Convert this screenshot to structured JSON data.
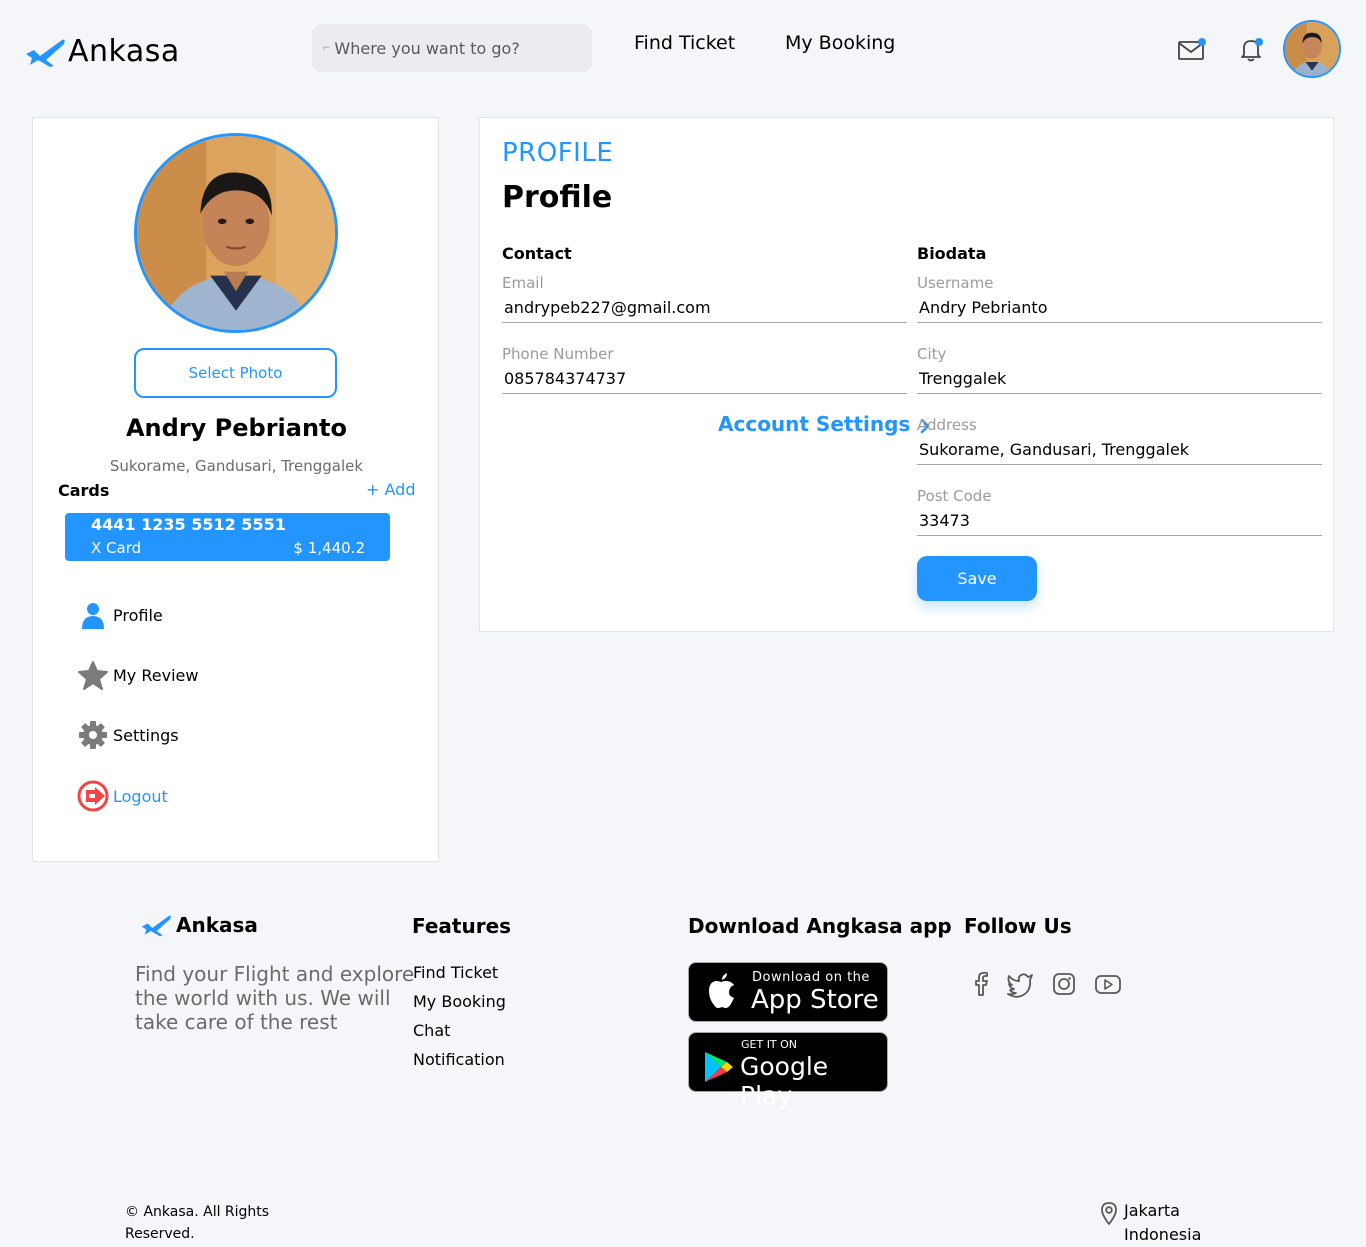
{
  "header": {
    "brand": "Ankasa",
    "search_placeholder": "Where you want to go?",
    "nav": [
      "Find Ticket",
      "My Booking"
    ]
  },
  "sidebar": {
    "select_photo_label": "Select Photo",
    "user_name": "Andry Pebrianto",
    "user_address": "Sukorame, Gandusari, Trenggalek",
    "cards_label": "Cards",
    "add_label": "+ Add",
    "card": {
      "number": "4441 1235 5512 5551",
      "name": "X Card",
      "balance": "$ 1,440.2"
    },
    "menu": [
      {
        "label": "Profile",
        "icon": "user-icon"
      },
      {
        "label": "My Review",
        "icon": "star-icon"
      },
      {
        "label": "Settings",
        "icon": "gear-icon"
      },
      {
        "label": "Logout",
        "icon": "logout-icon"
      }
    ]
  },
  "profile": {
    "kicker": "PROFILE",
    "title": "Profile",
    "contact_title": "Contact",
    "biodata_title": "Biodata",
    "account_settings": "Account Settings",
    "save_label": "Save",
    "fields": {
      "email": {
        "label": "Email",
        "value": "andrypeb227@gmail.com"
      },
      "phone": {
        "label": "Phone Number",
        "value": "085784374737"
      },
      "username": {
        "label": "Username",
        "value": "Andry Pebrianto"
      },
      "city": {
        "label": "City",
        "value": "Trenggalek"
      },
      "address": {
        "label": "Address",
        "value": "Sukorame, Gandusari, Trenggalek"
      },
      "postcode": {
        "label": "Post Code",
        "value": "33473"
      }
    }
  },
  "footer": {
    "brand": "Ankasa",
    "description": "Find your Flight and explore the world with us. We will take care of the rest",
    "features_title": "Features",
    "features": [
      "Find Ticket",
      "My Booking",
      "Chat",
      "Notification"
    ],
    "download_title": "Download Angkasa app",
    "app_store": {
      "small": "Download on the",
      "big": "App Store"
    },
    "google_play": {
      "small": "GET IT ON",
      "big": "Google Play"
    },
    "follow_title": "Follow Us",
    "social_icons": [
      "facebook-icon",
      "twitter-icon",
      "instagram-icon",
      "youtube-icon"
    ],
    "copyright": "© Ankasa. All Rights Reserved.",
    "location": {
      "city": "Jakarta",
      "country": "Indonesia"
    }
  },
  "colors": {
    "primary": "#2395ff",
    "background": "#f5f6fa",
    "logout_red": "#f24545"
  }
}
